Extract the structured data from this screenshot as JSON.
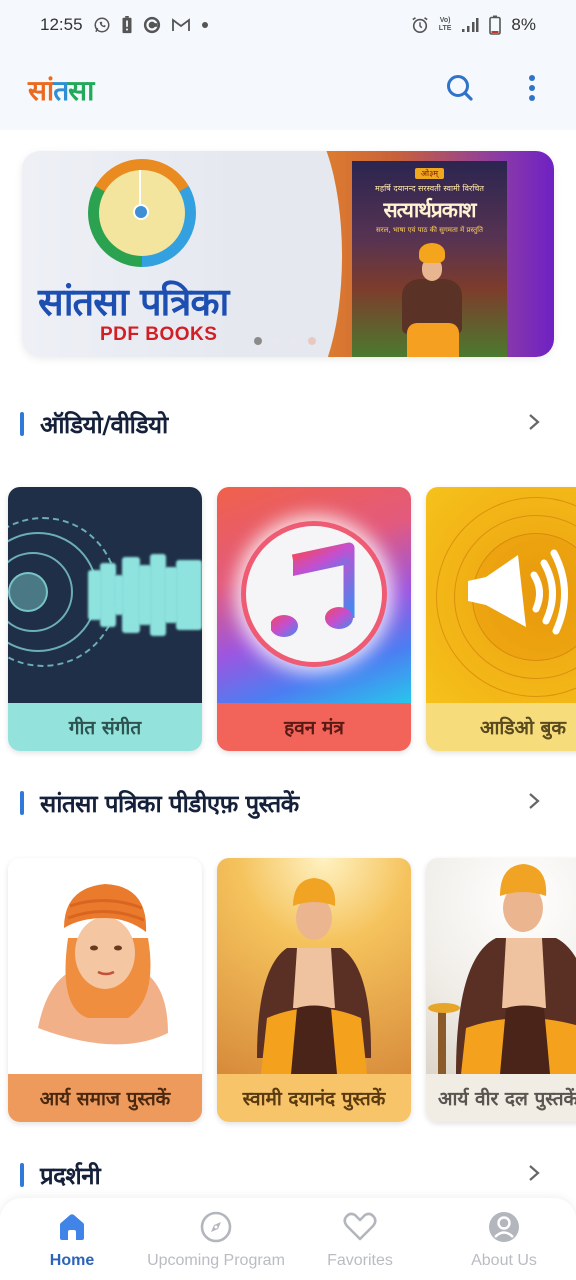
{
  "status_bar": {
    "time": "12:55",
    "battery_percent": "8%",
    "left_icons": [
      "whatsapp-icon",
      "battery-alert-icon",
      "circle-app-icon",
      "gmail-icon",
      "more-dot-icon"
    ],
    "right_icons": [
      "alarm-icon",
      "volte-lte-icon",
      "signal-icon",
      "battery-icon"
    ],
    "volte_label": "Vo)",
    "lte_label": "LTE"
  },
  "app_bar": {
    "logo_parts": [
      "सां",
      "त",
      "सा"
    ],
    "search_icon": "search-icon",
    "menu_icon": "more-vert-icon"
  },
  "banner": {
    "title": "सांतसा  पत्रिका",
    "subtitle": "PDF BOOKS",
    "book_tag": "ओ३म्",
    "book_author": "महर्षि दयानन्द सरस्वती स्वामी विरचित",
    "book_title": "सत्यार्थप्रकाश",
    "book_line": "सरल, भाषा एवं पाठ की सुगमता में प्रस्तुति",
    "slides_total": 4,
    "active_slide": 1
  },
  "sections": [
    {
      "title": "ऑडियो/वीडियो",
      "cards": [
        {
          "label": "गीत संगीत",
          "label_bg": "#93e2dc",
          "label_color": "#2d5450"
        },
        {
          "label": "हवन मंत्र",
          "label_bg": "#f2645a",
          "label_color": "#5a1a14"
        },
        {
          "label": "आडिओ बुक",
          "label_bg": "#f6dc7a",
          "label_color": "#5a4a20"
        }
      ]
    },
    {
      "title": "सांतसा पत्रिका पीडीएफ़ पुस्तकें",
      "cards": [
        {
          "label": "आर्य समाज पुस्तकें",
          "label_bg": "#ee9a5c",
          "label_color": "#4a2810"
        },
        {
          "label": "स्वामी दयानंद पुस्तकें",
          "label_bg": "#f7c46a",
          "label_color": "#5a3a10"
        },
        {
          "label": "आर्य वीर दल पुस्तकें",
          "label_bg": "#f1ede4",
          "label_color": "#5a5550"
        }
      ]
    },
    {
      "title": "प्रदर्शनी",
      "cards": []
    }
  ],
  "bottom_nav": {
    "items": [
      {
        "label": "Home",
        "icon": "home-icon",
        "active": true
      },
      {
        "label": "Upcoming Program",
        "icon": "compass-icon",
        "active": false
      },
      {
        "label": "Favorites",
        "icon": "heart-icon",
        "active": false
      },
      {
        "label": "About Us",
        "icon": "account-icon",
        "active": false
      }
    ]
  },
  "colors": {
    "accent": "#2f7ad9",
    "nav_active": "#2c64b8",
    "nav_inactive": "#b9bcc2",
    "heading": "#15213a"
  }
}
